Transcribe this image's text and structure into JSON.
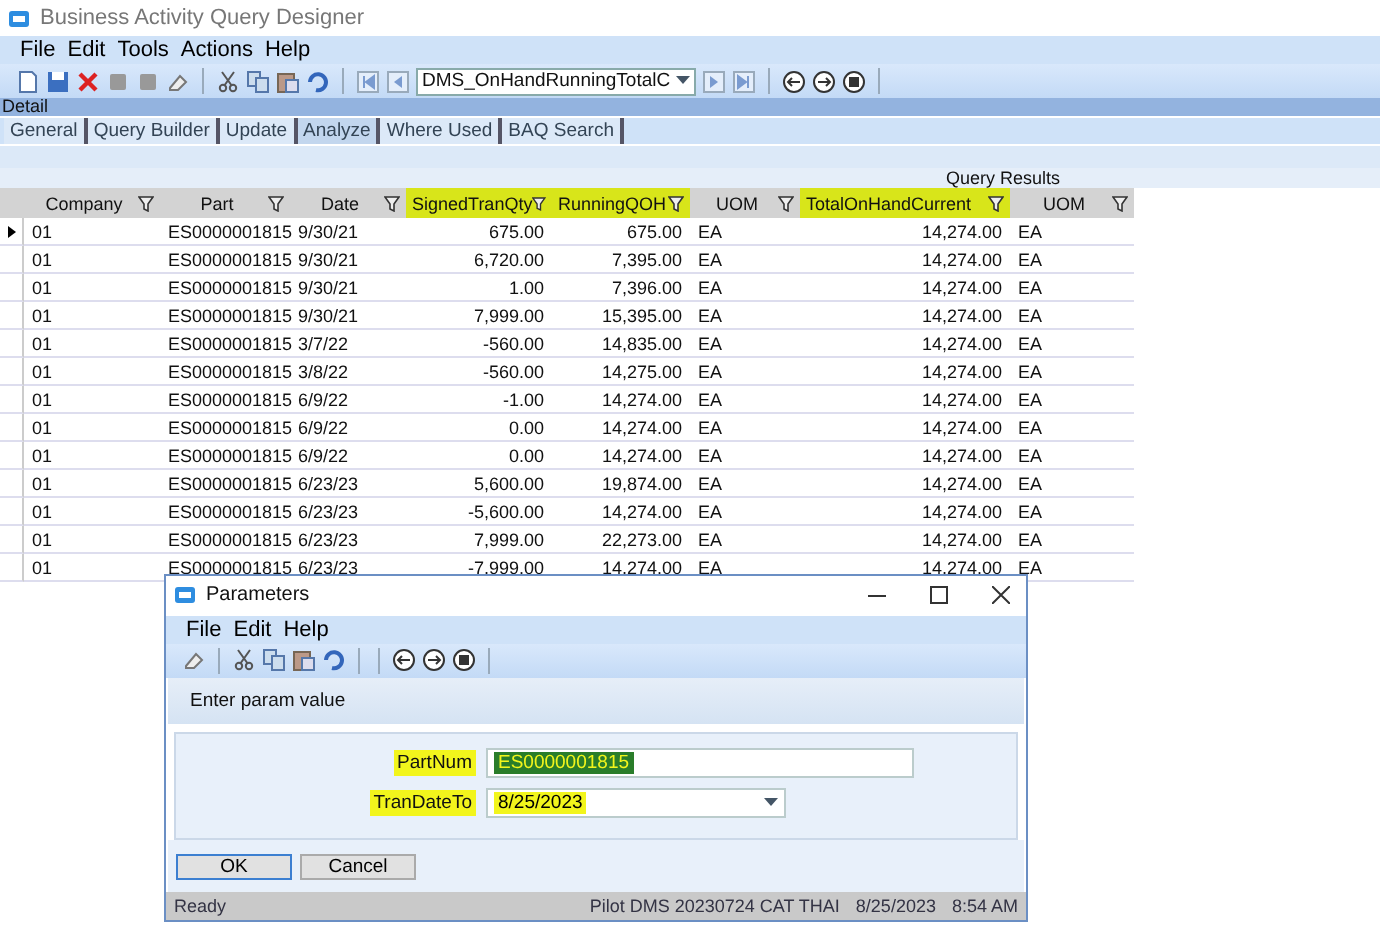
{
  "window": {
    "title": "Business Activity Query Designer"
  },
  "menu": [
    "File",
    "Edit",
    "Tools",
    "Actions",
    "Help"
  ],
  "toolbar": {
    "query_combo": "DMS_OnHandRunningTotalC"
  },
  "section_title": "Detail",
  "tabs": [
    {
      "label": "General",
      "selected": false
    },
    {
      "label": "Query Builder",
      "selected": false
    },
    {
      "label": "Update",
      "selected": false
    },
    {
      "label": "Analyze",
      "selected": true
    },
    {
      "label": "Where Used",
      "selected": false
    },
    {
      "label": "BAQ Search",
      "selected": false
    }
  ],
  "results": {
    "title": "Query Results",
    "columns": [
      {
        "label": "Company",
        "highlighted": false
      },
      {
        "label": "Part",
        "highlighted": false
      },
      {
        "label": "Date",
        "highlighted": false
      },
      {
        "label": "SignedTranQty",
        "highlighted": true
      },
      {
        "label": "RunningQOH",
        "highlighted": true
      },
      {
        "label": "UOM",
        "highlighted": false
      },
      {
        "label": "TotalOnHandCurrent",
        "highlighted": true
      },
      {
        "label": "UOM",
        "highlighted": false
      }
    ],
    "rows": [
      {
        "current": true,
        "cells": [
          "01",
          "ES0000001815",
          "9/30/21",
          "675.00",
          "675.00",
          "EA",
          "14,274.00",
          "EA"
        ]
      },
      {
        "current": false,
        "cells": [
          "01",
          "ES0000001815",
          "9/30/21",
          "6,720.00",
          "7,395.00",
          "EA",
          "14,274.00",
          "EA"
        ]
      },
      {
        "current": false,
        "cells": [
          "01",
          "ES0000001815",
          "9/30/21",
          "1.00",
          "7,396.00",
          "EA",
          "14,274.00",
          "EA"
        ]
      },
      {
        "current": false,
        "cells": [
          "01",
          "ES0000001815",
          "9/30/21",
          "7,999.00",
          "15,395.00",
          "EA",
          "14,274.00",
          "EA"
        ]
      },
      {
        "current": false,
        "cells": [
          "01",
          "ES0000001815",
          "3/7/22",
          "-560.00",
          "14,835.00",
          "EA",
          "14,274.00",
          "EA"
        ]
      },
      {
        "current": false,
        "cells": [
          "01",
          "ES0000001815",
          "3/8/22",
          "-560.00",
          "14,275.00",
          "EA",
          "14,274.00",
          "EA"
        ]
      },
      {
        "current": false,
        "cells": [
          "01",
          "ES0000001815",
          "6/9/22",
          "-1.00",
          "14,274.00",
          "EA",
          "14,274.00",
          "EA"
        ]
      },
      {
        "current": false,
        "cells": [
          "01",
          "ES0000001815",
          "6/9/22",
          "0.00",
          "14,274.00",
          "EA",
          "14,274.00",
          "EA"
        ]
      },
      {
        "current": false,
        "cells": [
          "01",
          "ES0000001815",
          "6/9/22",
          "0.00",
          "14,274.00",
          "EA",
          "14,274.00",
          "EA"
        ]
      },
      {
        "current": false,
        "cells": [
          "01",
          "ES0000001815",
          "6/23/23",
          "5,600.00",
          "19,874.00",
          "EA",
          "14,274.00",
          "EA"
        ]
      },
      {
        "current": false,
        "cells": [
          "01",
          "ES0000001815",
          "6/23/23",
          "-5,600.00",
          "14,274.00",
          "EA",
          "14,274.00",
          "EA"
        ]
      },
      {
        "current": false,
        "cells": [
          "01",
          "ES0000001815",
          "6/23/23",
          "7,999.00",
          "22,273.00",
          "EA",
          "14,274.00",
          "EA"
        ]
      },
      {
        "current": false,
        "cells": [
          "01",
          "ES0000001815",
          "6/23/23",
          "-7,999.00",
          "14,274.00",
          "EA",
          "14,274.00",
          "EA"
        ]
      }
    ]
  },
  "dialog": {
    "title": "Parameters",
    "menu": [
      "File",
      "Edit",
      "Help"
    ],
    "prompt": "Enter param value",
    "params": [
      {
        "label": "PartNum",
        "kind": "text",
        "value": "ES0000001815",
        "highlighted": true,
        "text_selected": true
      },
      {
        "label": "TranDateTo",
        "kind": "dropdown",
        "value": "8/25/2023",
        "highlighted": true,
        "text_selected": false
      }
    ],
    "buttons": [
      {
        "label": "OK",
        "default": true
      },
      {
        "label": "Cancel",
        "default": false
      }
    ],
    "status": {
      "message": "Ready",
      "session": "Pilot DMS 20230724 CAT THAI",
      "date": "8/25/2023",
      "time": "8:54 AM"
    }
  }
}
